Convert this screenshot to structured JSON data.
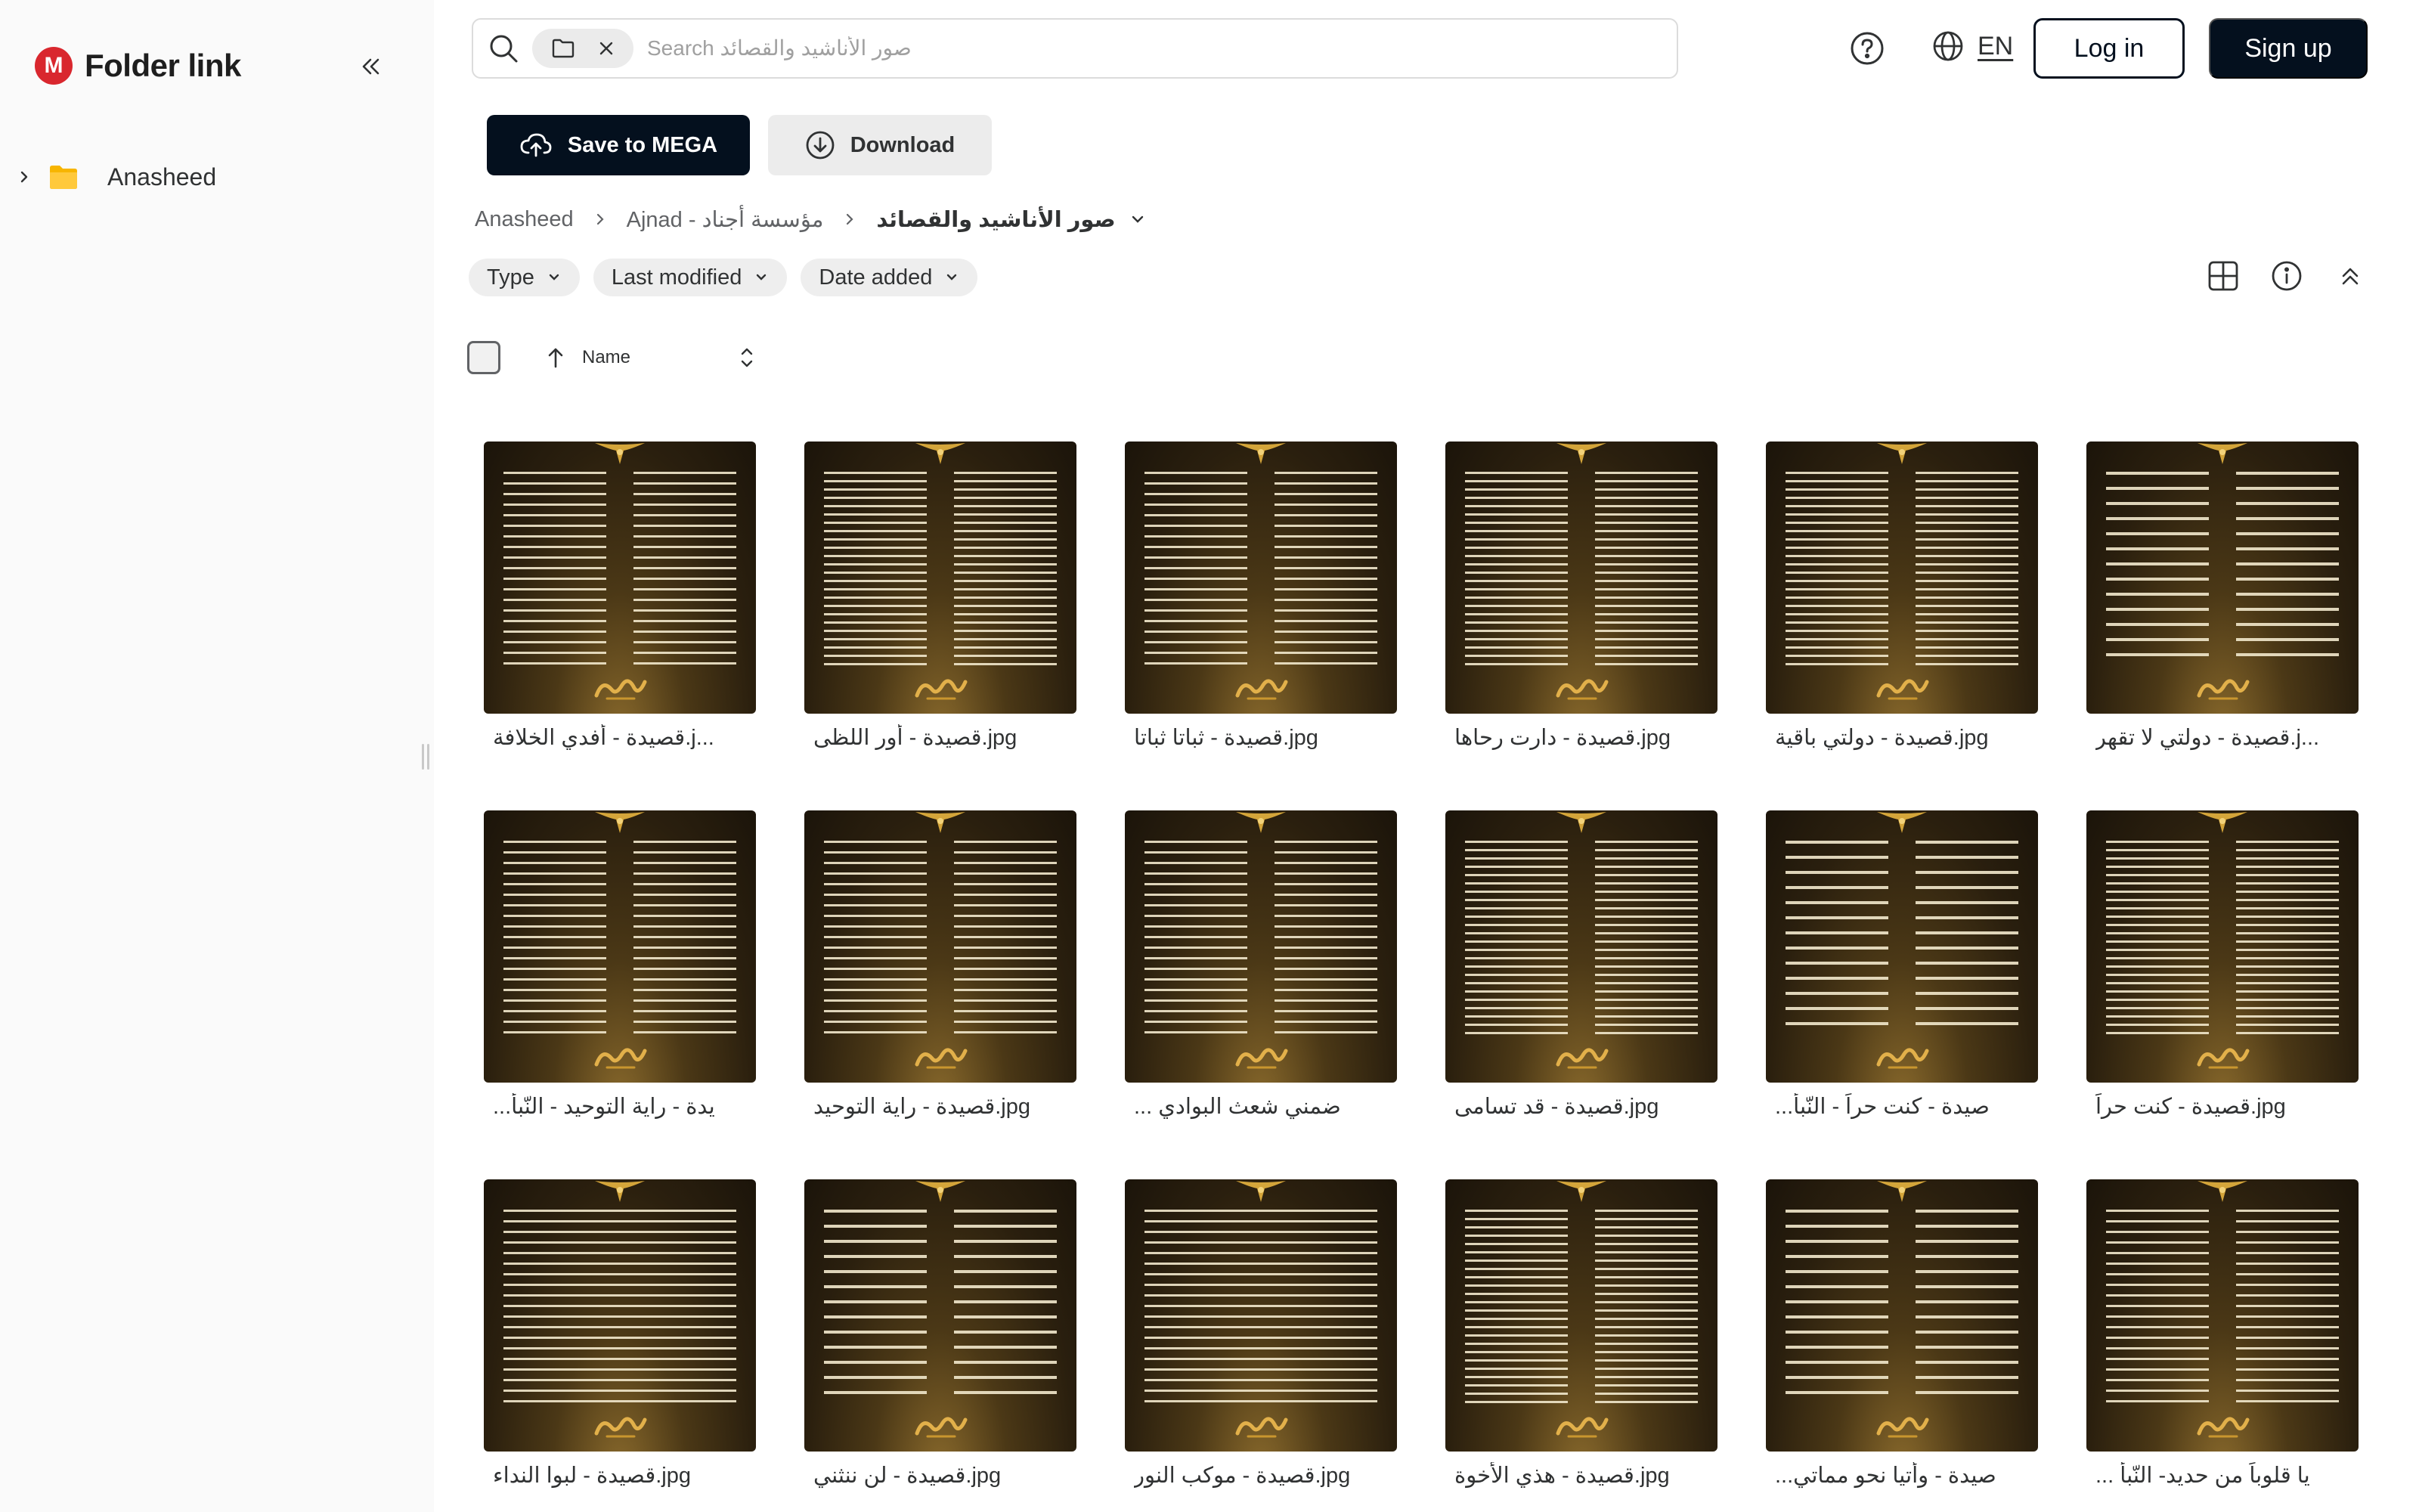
{
  "app": {
    "logo_letter": "M",
    "logo_text": "Folder link",
    "brand_color": "#d9272e"
  },
  "sidebar": {
    "items": [
      {
        "label": "Anasheed",
        "icon": "folder-icon"
      }
    ]
  },
  "search": {
    "placeholder": "Search صور الأناشيد والقصائد",
    "value": ""
  },
  "header": {
    "language": "EN",
    "login_label": "Log in",
    "signup_label": "Sign up"
  },
  "actions": {
    "save_label": "Save to MEGA",
    "download_label": "Download"
  },
  "breadcrumb": {
    "items": [
      "Anasheed",
      "Ajnad - مؤسسة أجناد",
      "صور الأناشيد والقصائد"
    ]
  },
  "filters": {
    "items": [
      "Type",
      "Last modified",
      "Date added"
    ]
  },
  "list": {
    "name_header": "Name"
  },
  "files": [
    {
      "name": "قصيدة - أفدي الخلافة.j..."
    },
    {
      "name": "قصيدة - أور اللظى.jpg"
    },
    {
      "name": "قصيدة - ثباتا ثباتا.jpg"
    },
    {
      "name": "قصيدة - دارت رحاها.jpg"
    },
    {
      "name": "قصيدة - دولتي باقية.jpg"
    },
    {
      "name": "قصيدة - دولتي لا تقهر.j..."
    },
    {
      "name": "...يدة - راية التوحيد - النّبأ"
    },
    {
      "name": "قصيدة - راية التوحيد.jpg"
    },
    {
      "name": "... ضمني شعث البوادي"
    },
    {
      "name": "قصيدة - قد تسامى.jpg"
    },
    {
      "name": "...صيدة - كنت حراً - النّبأ"
    },
    {
      "name": "قصيدة - كنت حراً.jpg"
    },
    {
      "name": "قصيدة - لبوا النداء.jpg"
    },
    {
      "name": "قصيدة - لن ننثني.jpg"
    },
    {
      "name": "قصيدة - موكب النور.jpg"
    },
    {
      "name": "قصيدة - هذي الأخوة.jpg"
    },
    {
      "name": "...صيدة - وأتيا نحو مماتي"
    },
    {
      "name": "... يا قلوباً من حديد- النّبأ"
    }
  ]
}
